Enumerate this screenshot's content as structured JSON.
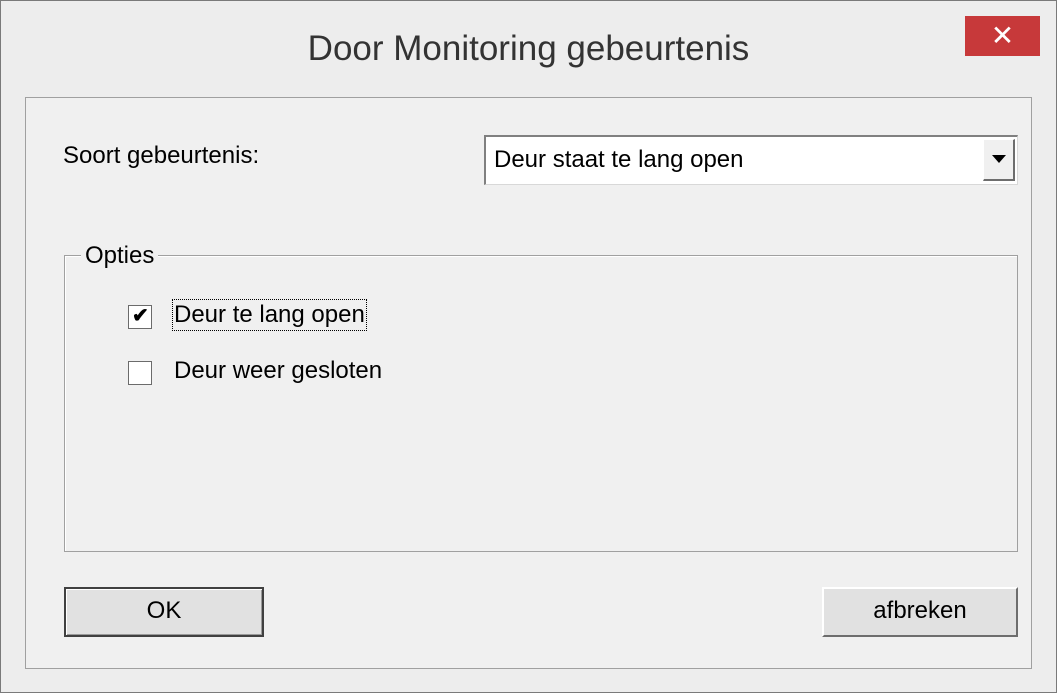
{
  "window": {
    "title": "Door Monitoring gebeurtenis",
    "close_glyph": "✕",
    "close_icon": "close-icon",
    "close_color": "#c7393a"
  },
  "form": {
    "event_type_label": "Soort gebeurtenis:",
    "event_type_value": "Deur staat te lang open"
  },
  "options": {
    "legend": "Opties",
    "items": [
      {
        "label": "Deur te lang open",
        "checked": true
      },
      {
        "label": "Deur weer gesloten",
        "checked": false
      }
    ]
  },
  "buttons": {
    "ok_label": "OK",
    "cancel_label": "afbreken"
  }
}
